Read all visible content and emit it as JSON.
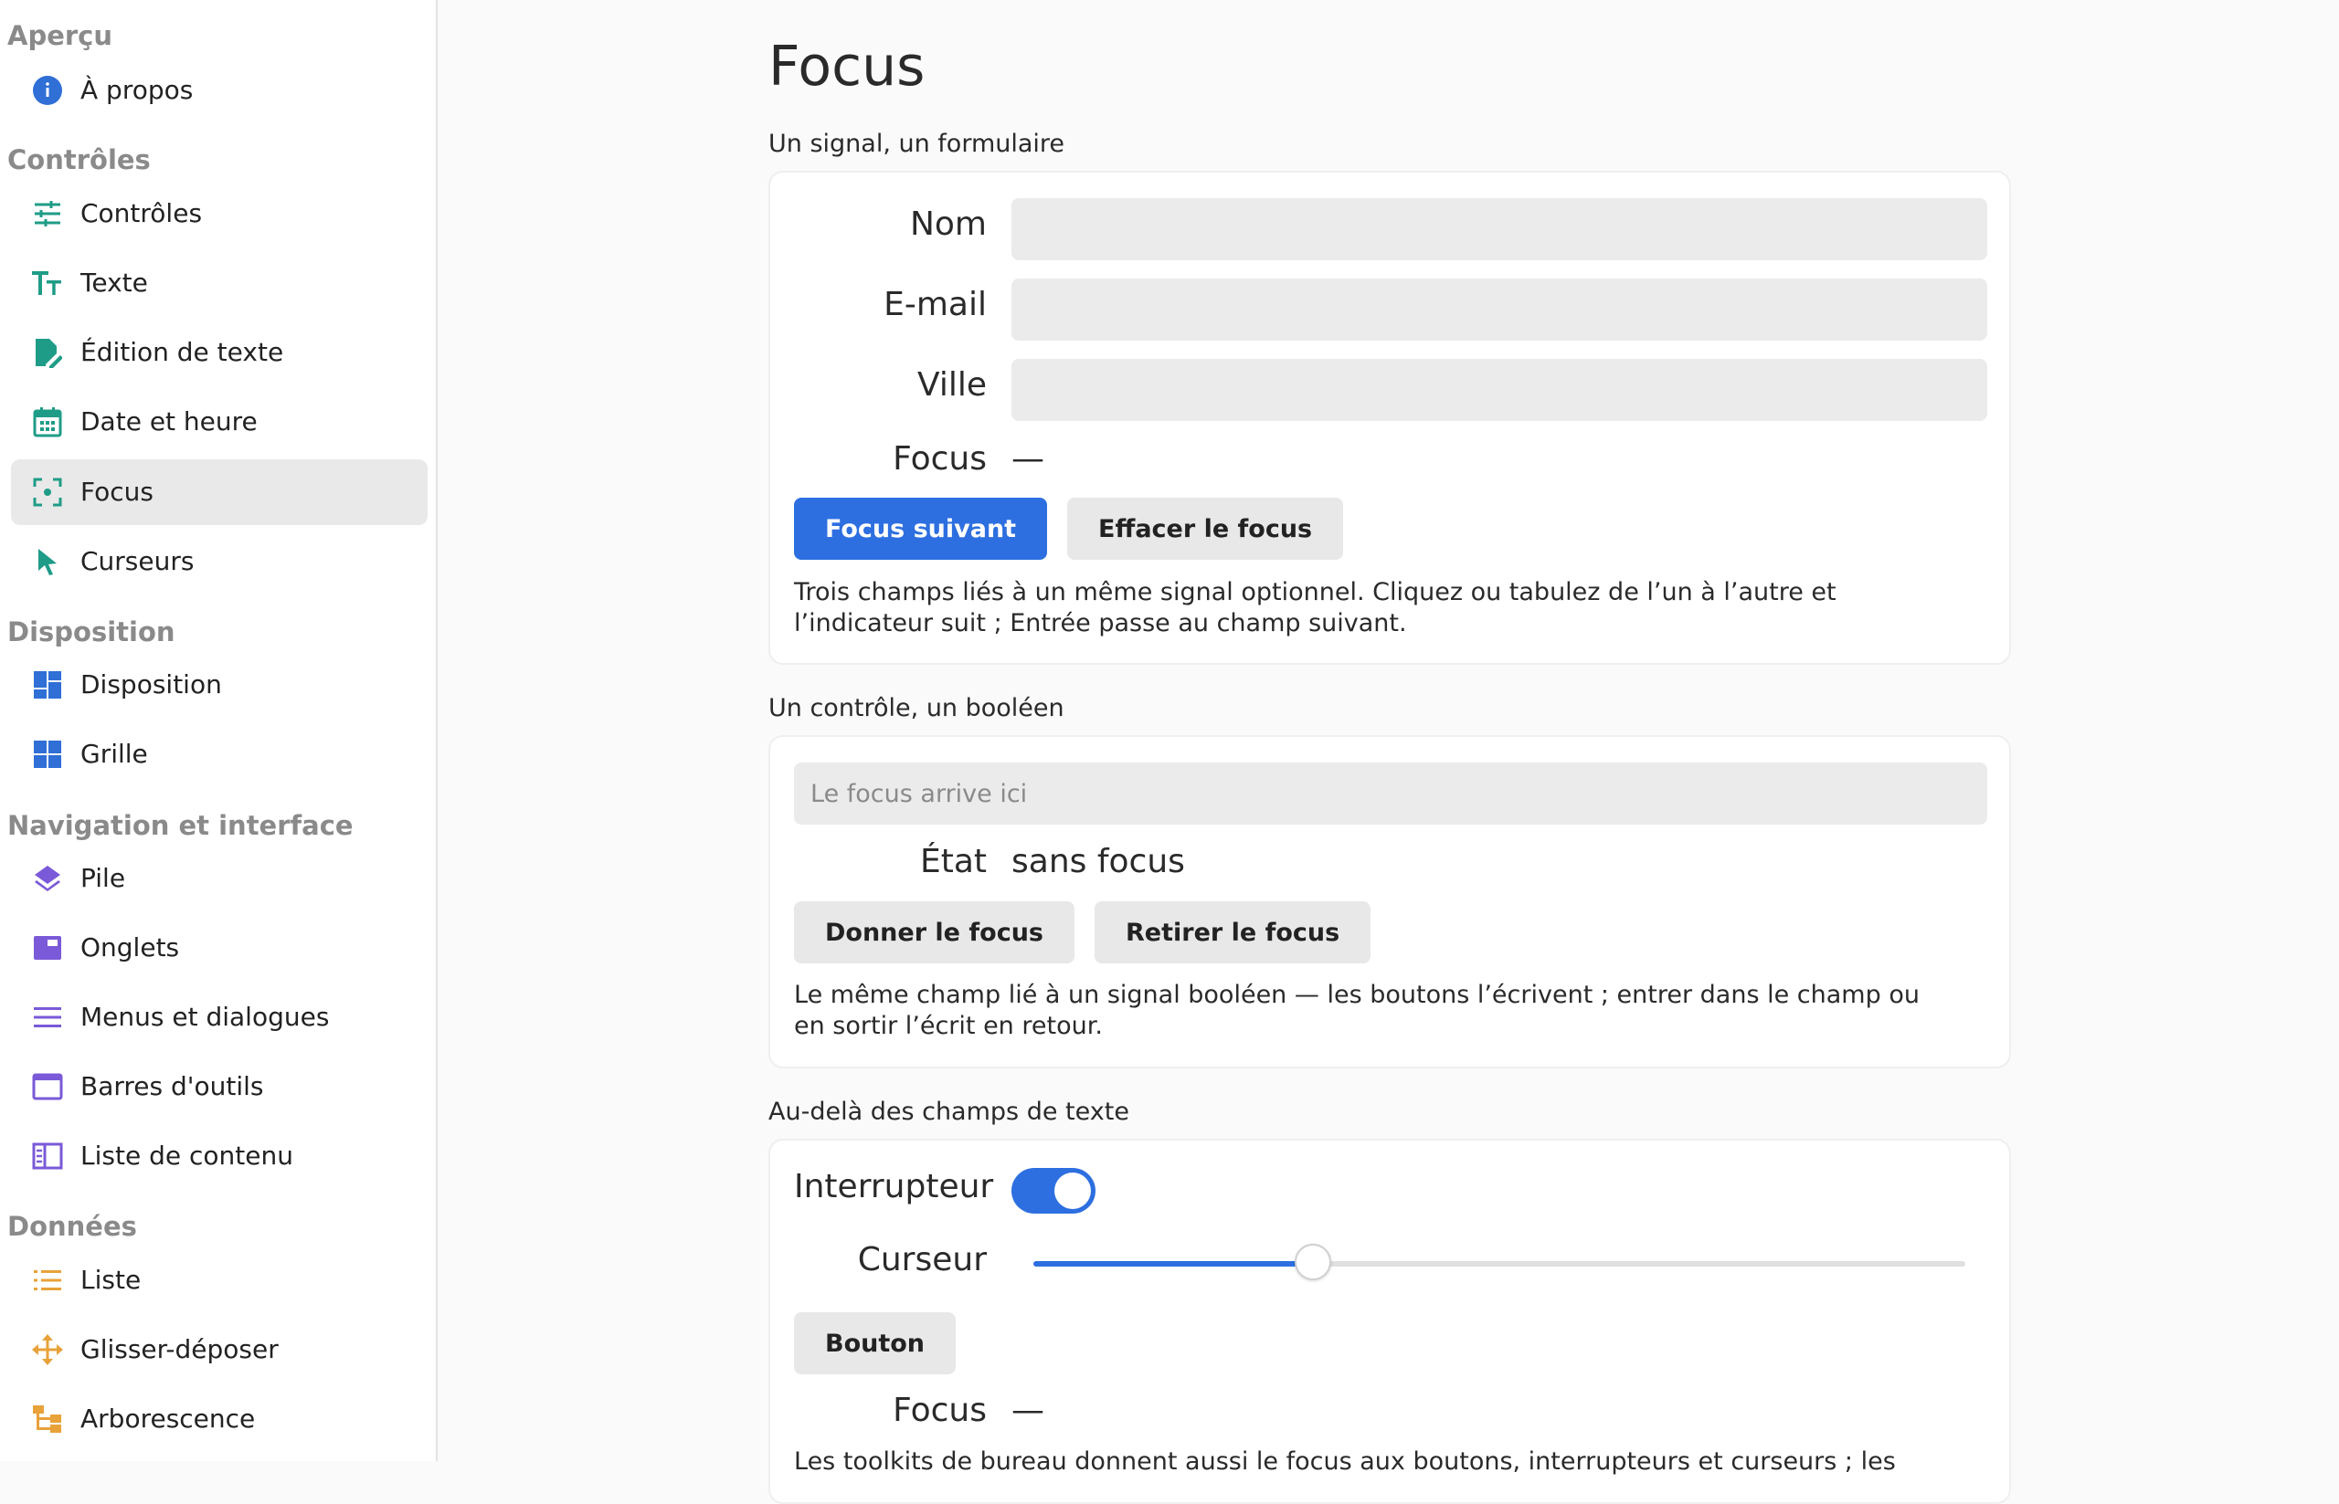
{
  "sidebar": {
    "sections": [
      {
        "title": "Aperçu",
        "items": [
          {
            "label": "À propos",
            "icon": "info-icon"
          }
        ]
      },
      {
        "title": "Contrôles",
        "items": [
          {
            "label": "Contrôles",
            "icon": "sliders-icon"
          },
          {
            "label": "Texte",
            "icon": "text-icon"
          },
          {
            "label": "Édition de texte",
            "icon": "edit-document-icon"
          },
          {
            "label": "Date et heure",
            "icon": "calendar-icon"
          },
          {
            "label": "Focus",
            "icon": "focus-icon",
            "active": true
          },
          {
            "label": "Curseurs",
            "icon": "pointer-icon"
          }
        ]
      },
      {
        "title": "Disposition",
        "items": [
          {
            "label": "Disposition",
            "icon": "dashboard-icon"
          },
          {
            "label": "Grille",
            "icon": "grid-icon"
          }
        ]
      },
      {
        "title": "Navigation et interface",
        "items": [
          {
            "label": "Pile",
            "icon": "layers-icon"
          },
          {
            "label": "Onglets",
            "icon": "tabs-icon"
          },
          {
            "label": "Menus et dialogues",
            "icon": "menu-icon"
          },
          {
            "label": "Barres d'outils",
            "icon": "window-icon"
          },
          {
            "label": "Liste de contenu",
            "icon": "book-icon"
          }
        ]
      },
      {
        "title": "Données",
        "items": [
          {
            "label": "Liste",
            "icon": "list-icon"
          },
          {
            "label": "Glisser-déposer",
            "icon": "move-icon"
          },
          {
            "label": "Arborescence",
            "icon": "tree-icon"
          }
        ]
      }
    ]
  },
  "main": {
    "title": "Focus",
    "card1": {
      "heading": "Un signal, un formulaire",
      "fields": [
        {
          "label": "Nom",
          "value": ""
        },
        {
          "label": "E-mail",
          "value": ""
        },
        {
          "label": "Ville",
          "value": ""
        }
      ],
      "focus_label": "Focus",
      "focus_value": "—",
      "next_button": "Focus suivant",
      "clear_button": "Effacer le focus",
      "description": "Trois champs liés à un même signal optionnel. Cliquez ou tabulez de l’un à l’autre et l’indicateur suit ; Entrée passe au champ suivant."
    },
    "card2": {
      "heading": "Un contrôle, un booléen",
      "input_placeholder": "Le focus arrive ici",
      "state_label": "État",
      "state_value": "sans focus",
      "give_button": "Donner le focus",
      "remove_button": "Retirer le focus",
      "description": "Le même champ lié à un signal booléen — les boutons l’écrivent ; entrer dans le champ ou en sortir l’écrit en retour."
    },
    "card3": {
      "heading": "Au-delà des champs de texte",
      "toggle_label": "Interrupteur",
      "toggle_on": true,
      "slider_label": "Curseur",
      "slider_value": 0.3,
      "button_label": "Bouton",
      "focus_label": "Focus",
      "focus_value": "—",
      "description": "Les toolkits de bureau donnent aussi le focus aux boutons, interrupteurs et curseurs ; les"
    }
  },
  "colors": {
    "accent": "#2d6fe0",
    "teal": "#1f9c87",
    "blue": "#2f6fd6",
    "purple": "#7a5ad8",
    "orange": "#e8a23a"
  }
}
